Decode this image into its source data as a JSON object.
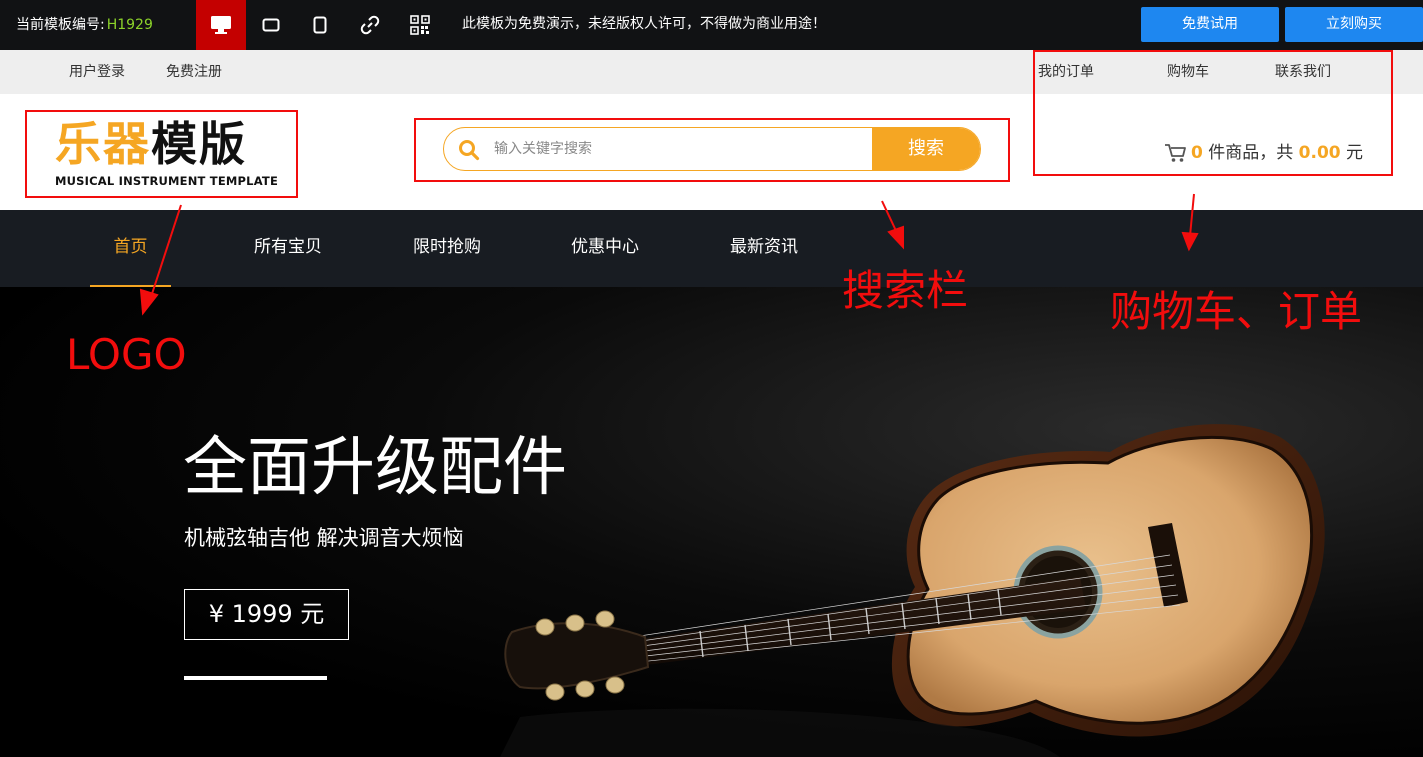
{
  "topbar": {
    "template_code_label": "当前模板编号:",
    "template_code": "H1929",
    "devices": [
      {
        "name": "desktop-icon",
        "active": true
      },
      {
        "name": "tablet-landscape-icon",
        "active": false
      },
      {
        "name": "tablet-portrait-icon",
        "active": false
      },
      {
        "name": "link-icon",
        "active": false
      },
      {
        "name": "qrcode-icon",
        "active": false
      }
    ],
    "notice": "此模板为免费演示，未经版权人许可，不得做为商业用途！",
    "free_trial_label": "免费试用",
    "buy_now_label": "立刻购买",
    "accent": "#1e87f0",
    "active_device_color": "#c40000"
  },
  "userbar": {
    "login": "用户登录",
    "register": "免费注册",
    "my_orders": "我的订单",
    "cart": "购物车",
    "contact": "联系我们"
  },
  "header": {
    "logo_cn_part1": "乐器",
    "logo_cn_part2": "模版",
    "logo_en": "MUSICAL INSTRUMENT TEMPLATE",
    "search_placeholder": "输入关键字搜索",
    "search_button": "搜索",
    "cart_count": "0",
    "cart_text_items": " 件商品，共 ",
    "cart_total": "0.00",
    "cart_currency": " 元",
    "brand_color": "#f5a623"
  },
  "nav": {
    "items": [
      {
        "label": "首页",
        "active": true
      },
      {
        "label": "所有宝贝",
        "active": false
      },
      {
        "label": "限时抢购",
        "active": false
      },
      {
        "label": "优惠中心",
        "active": false
      },
      {
        "label": "最新资讯",
        "active": false
      }
    ]
  },
  "banner": {
    "title": "全面升级配件",
    "subtitle": "机械弦轴吉他 解决调音大烦恼",
    "price": "¥ 1999 元"
  },
  "annotations": {
    "logo_label": "LOGO",
    "search_label": "搜索栏",
    "cart_label": "购物车、订单",
    "color": "#f20d0d"
  }
}
